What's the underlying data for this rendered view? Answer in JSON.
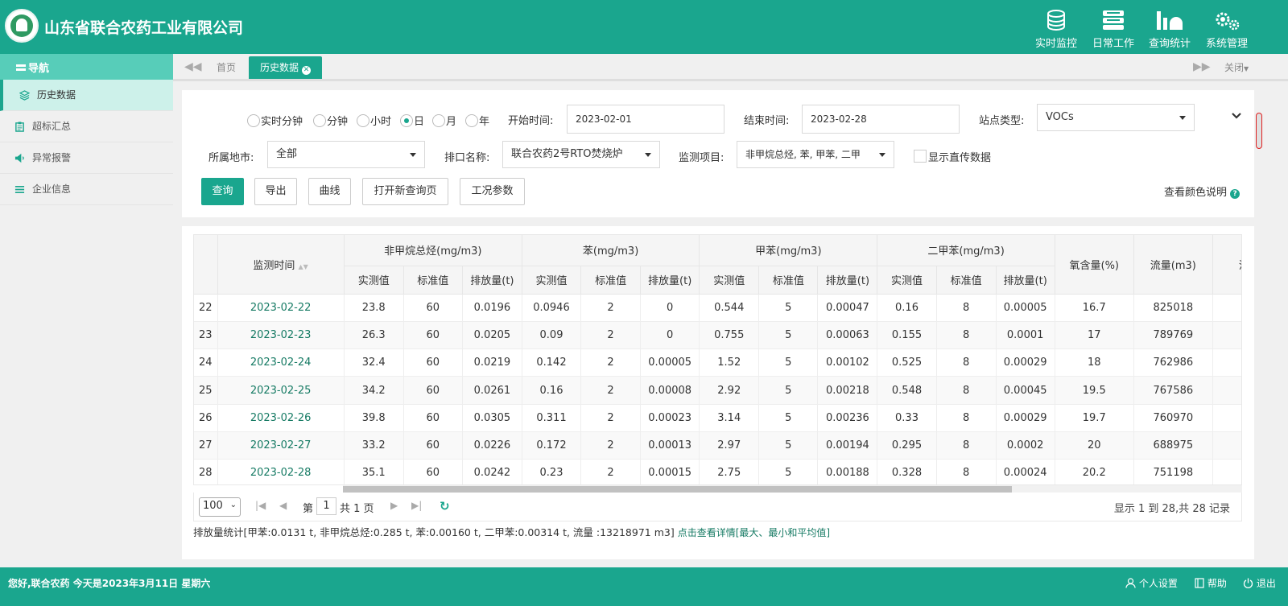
{
  "header": {
    "company": "山东省联合农药工业有限公司",
    "nav": [
      {
        "label": "实时监控",
        "icon": "database-icon"
      },
      {
        "label": "日常工作",
        "icon": "server-icon"
      },
      {
        "label": "查询统计",
        "icon": "bar-chart-icon"
      },
      {
        "label": "系统管理",
        "icon": "gears-icon"
      }
    ]
  },
  "sidebar": {
    "title": "导航",
    "items": [
      {
        "label": "历史数据",
        "icon": "layers-icon"
      },
      {
        "label": "超标汇总",
        "icon": "clipboard-icon"
      },
      {
        "label": "异常报警",
        "icon": "speaker-icon"
      },
      {
        "label": "企业信息",
        "icon": "list-icon"
      }
    ]
  },
  "tabs": {
    "home": "首页",
    "active": "历史数据",
    "close_menu": "关闭"
  },
  "filters": {
    "radios": [
      "实时分钟",
      "分钟",
      "小时",
      "日",
      "月",
      "年"
    ],
    "selected_radio": "日",
    "start_label": "开始时间:",
    "start_value": "2023-02-01",
    "end_label": "结束时间:",
    "end_value": "2023-02-28",
    "site_type_label": "站点类型:",
    "site_type_value": "VOCs",
    "city_label": "所属地市:",
    "city_value": "全部",
    "outlet_label": "排口名称:",
    "outlet_value": "联合农药2号RTO焚烧炉",
    "monitor_label": "监测项目:",
    "monitor_value": "非甲烷总烃, 苯, 甲苯, 二甲",
    "direct_label": "显示直传数据",
    "color_help": "查看颜色说明"
  },
  "buttons": {
    "query": "查询",
    "export": "导出",
    "curve": "曲线",
    "new_page": "打开新查询页",
    "params": "工况参数"
  },
  "table": {
    "time_header": "监测时间",
    "groups": [
      "非甲烷总烃(mg/m3)",
      "苯(mg/m3)",
      "甲苯(mg/m3)",
      "二甲苯(mg/m3)"
    ],
    "sub_headers": [
      "实测值",
      "标准值",
      "排放量(t)"
    ],
    "extra_headers": [
      "氧含量(%)",
      "流量(m3)",
      "流"
    ],
    "rows": [
      {
        "n": "22",
        "date": "2023-02-22",
        "v": [
          "23.8",
          "60",
          "0.0196",
          "0.0946",
          "2",
          "0",
          "0.544",
          "5",
          "0.00047",
          "0.16",
          "8",
          "0.00005",
          "16.7",
          "825018"
        ]
      },
      {
        "n": "23",
        "date": "2023-02-23",
        "v": [
          "26.3",
          "60",
          "0.0205",
          "0.09",
          "2",
          "0",
          "0.755",
          "5",
          "0.00063",
          "0.155",
          "8",
          "0.0001",
          "17",
          "789769"
        ]
      },
      {
        "n": "24",
        "date": "2023-02-24",
        "v": [
          "32.4",
          "60",
          "0.0219",
          "0.142",
          "2",
          "0.00005",
          "1.52",
          "5",
          "0.00102",
          "0.525",
          "8",
          "0.00029",
          "18",
          "762986"
        ]
      },
      {
        "n": "25",
        "date": "2023-02-25",
        "v": [
          "34.2",
          "60",
          "0.0261",
          "0.16",
          "2",
          "0.00008",
          "2.92",
          "5",
          "0.00218",
          "0.548",
          "8",
          "0.00045",
          "19.5",
          "767586"
        ]
      },
      {
        "n": "26",
        "date": "2023-02-26",
        "v": [
          "39.8",
          "60",
          "0.0305",
          "0.311",
          "2",
          "0.00023",
          "3.14",
          "5",
          "0.00236",
          "0.33",
          "8",
          "0.00029",
          "19.7",
          "760970"
        ]
      },
      {
        "n": "27",
        "date": "2023-02-27",
        "v": [
          "33.2",
          "60",
          "0.0226",
          "0.172",
          "2",
          "0.00013",
          "2.97",
          "5",
          "0.00194",
          "0.295",
          "8",
          "0.0002",
          "20",
          "688975"
        ]
      },
      {
        "n": "28",
        "date": "2023-02-28",
        "v": [
          "35.1",
          "60",
          "0.0242",
          "0.23",
          "2",
          "0.00015",
          "2.75",
          "5",
          "0.00188",
          "0.328",
          "8",
          "0.00024",
          "20.2",
          "751198"
        ]
      }
    ]
  },
  "pager": {
    "page_size": "100",
    "page_prefix": "第",
    "page": "1",
    "page_suffix": "共 1 页",
    "info": "显示 1 到 28,共 28 记录"
  },
  "summary": {
    "text": "排放量统计[甲苯:0.0131 t, 非甲烷总烃:0.285 t, 苯:0.00160 t, 二甲苯:0.00314 t, 流量 :13218971 m3]",
    "link": "点击查看详情[最大、最小和平均值]"
  },
  "footer": {
    "greeting": "您好,联合农药 今天是2023年3月11日 星期六",
    "settings": "个人设置",
    "help": "帮助",
    "logout": "退出"
  }
}
